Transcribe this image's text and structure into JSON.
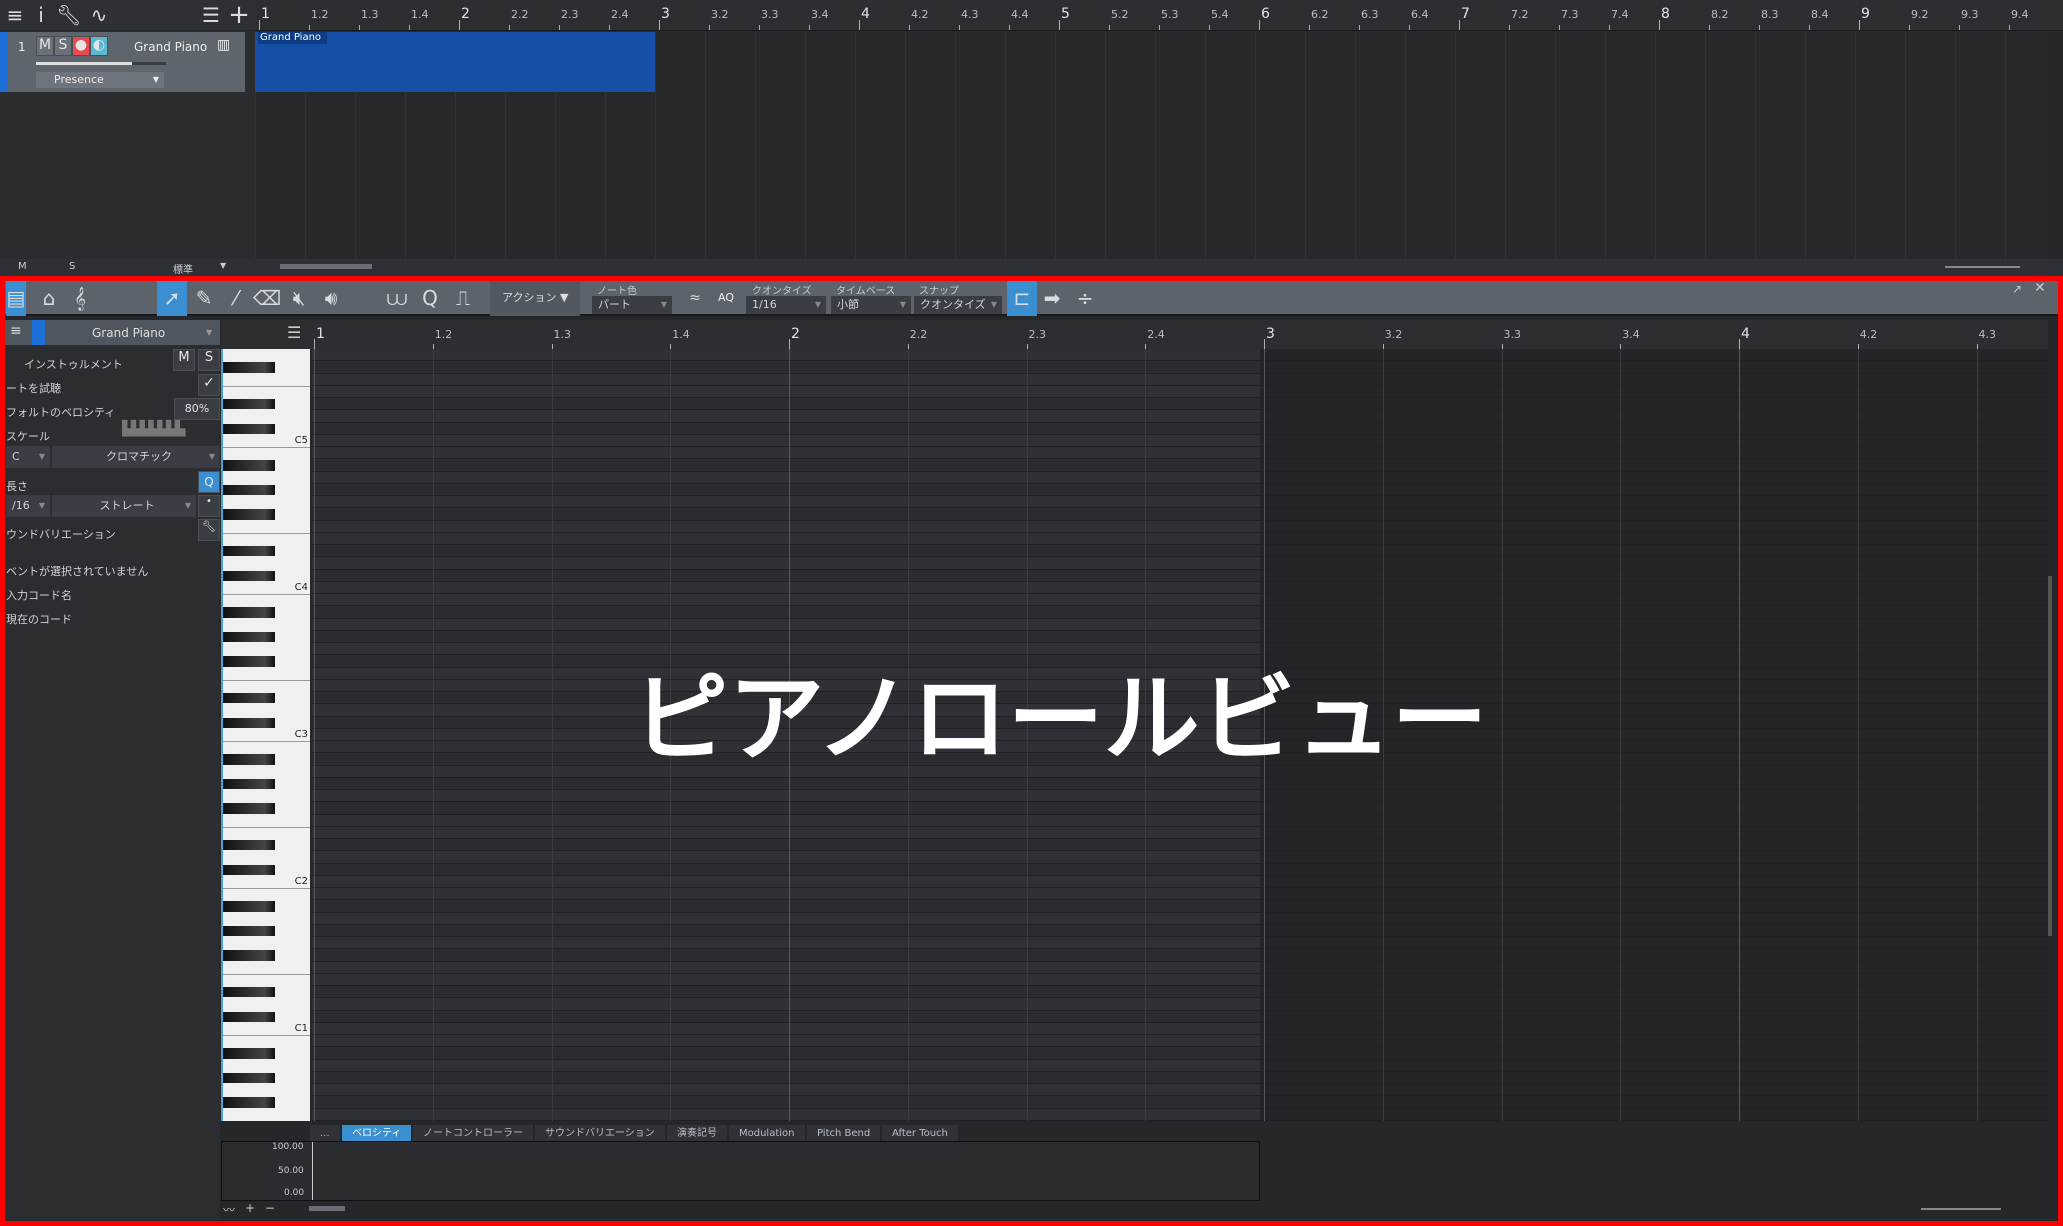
{
  "arrange": {
    "toolbar_icons": [
      "menu-icon",
      "info-icon",
      "wrench-icon",
      "automation-icon",
      "list-icon",
      "add-icon"
    ],
    "track": {
      "number": "1",
      "mute": "M",
      "solo": "S",
      "name": "Grand Piano",
      "preset": "Presence",
      "volume": 0.74
    },
    "region_label": "Grand Piano",
    "ruler": [
      "1",
      "1.2",
      "1.3",
      "1.4",
      "2",
      "2.2",
      "2.3",
      "2.4",
      "3",
      "3.2",
      "3.3",
      "3.4",
      "4",
      "4.2",
      "4.3",
      "4.4",
      "5",
      "5.2",
      "5.3",
      "5.4",
      "6",
      "6.2",
      "6.3",
      "6.4",
      "7",
      "7.2",
      "7.3",
      "7.4",
      "8",
      "8.2",
      "8.3",
      "8.4",
      "9",
      "9.2",
      "9.3",
      "9.4"
    ],
    "footer": {
      "m": "M",
      "s": "S",
      "layout": "標準"
    }
  },
  "editor": {
    "toolbar": {
      "action": "アクション",
      "note_color_label": "ノート色",
      "note_color": "パート",
      "aq": "AQ",
      "quantize_label": "クオンタイズ",
      "quantize": "1/16",
      "timebase_label": "タイムベース",
      "timebase": "小節",
      "snap_label": "スナップ",
      "snap": "クオンタイズ"
    },
    "inspector": {
      "title": "Grand Piano",
      "instrument": "インストゥルメント",
      "m": "M",
      "s": "S",
      "audition": "ートを試聴",
      "velocity_label": "フォルトのベロシティ",
      "velocity": "80%",
      "scale": "スケール",
      "key": "C",
      "scale_type": "クロマチック",
      "length": "長さ",
      "length_value": "/16",
      "length_type": "ストレート",
      "q": "Q",
      "sound_variation": "ウンドバリエーション",
      "no_event": "ベントが選択されていません",
      "chord_input": "入力コード名",
      "current_chord": "現在のコード"
    },
    "ruler": [
      "1",
      "1.2",
      "1.3",
      "1.4",
      "2",
      "2.2",
      "2.3",
      "2.4",
      "3",
      "3.2",
      "3.3",
      "3.4",
      "4",
      "4.2",
      "4.3"
    ],
    "octave_labels": [
      "C5",
      "C4",
      "C3",
      "C2",
      "C1"
    ],
    "overlay": "ピアノロールビュー",
    "tabs": [
      "...",
      "ベロシティ",
      "ノートコントローラー",
      "サウンドバリエーション",
      "演奏記号",
      "Modulation",
      "Pitch Bend",
      "After Touch"
    ],
    "active_tab": "ベロシティ",
    "velocity_axis": [
      "100.00",
      "50.00",
      "0.00"
    ]
  },
  "colors": {
    "accent": "#3a8fd0",
    "region": "#1550a6",
    "record": "#e8484e",
    "monitor": "#5ab8d0",
    "highlight_frame": "#ff0000"
  }
}
